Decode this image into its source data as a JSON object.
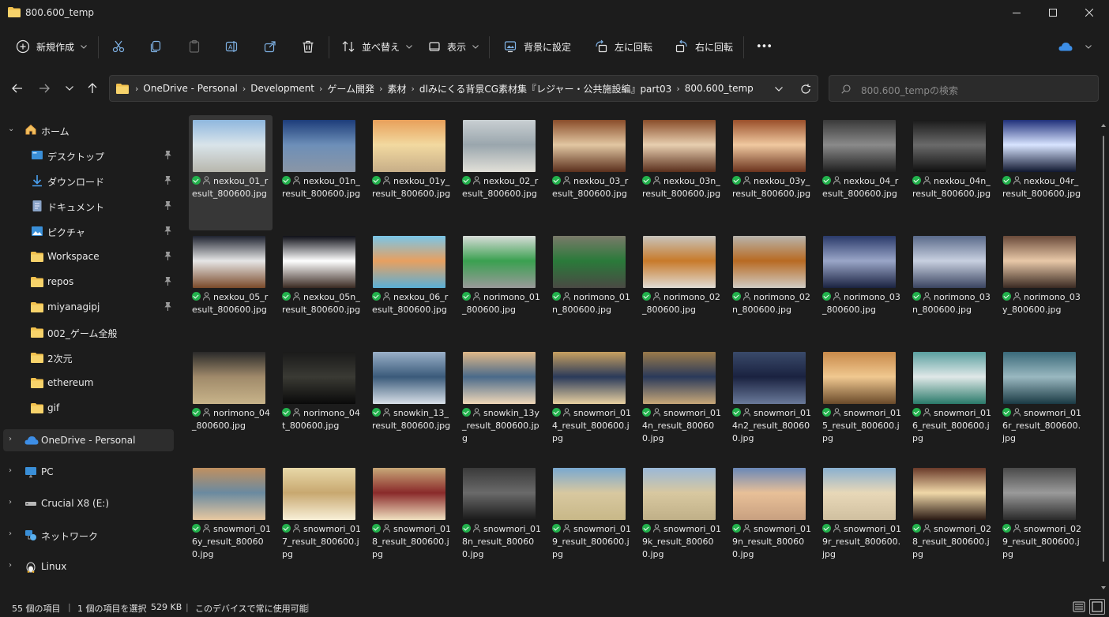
{
  "window": {
    "title": "800.600_temp"
  },
  "toolbar": {
    "new_label": "新規作成",
    "sort_label": "並べ替え",
    "view_label": "表示",
    "wallpaper_label": "背景に設定",
    "rotate_left_label": "左に回転",
    "rotate_right_label": "右に回転",
    "more_label": "•••"
  },
  "address": {
    "crumbs": [
      "OneDrive - Personal",
      "Development",
      "ゲーム開発",
      "素材",
      "dlみにくる背景CG素材集『レジャー・公共施設編』part03",
      "800.600_temp"
    ]
  },
  "search": {
    "placeholder": "800.600_tempの検索"
  },
  "sidebar": {
    "home": "ホーム",
    "quick": [
      "デスクトップ",
      "ダウンロード",
      "ドキュメント",
      "ピクチャ",
      "Workspace",
      "repos",
      "miyanagipj",
      "002_ゲーム全般",
      "2次元",
      "ethereum",
      "gif"
    ],
    "onedrive": "OneDrive - Personal",
    "pc": "PC",
    "drive": "Crucial X8 (E:)",
    "network": "ネットワーク",
    "linux": "Linux"
  },
  "files": [
    {
      "name": "nexkou_01_result_800600.jpg",
      "palette": [
        "#8fb7de",
        "#d9e4ea",
        "#b8b7ad"
      ]
    },
    {
      "name": "nexkou_01n_result_800600.jpg",
      "palette": [
        "#1d3d7a",
        "#6d8fb8",
        "#8a96a6"
      ]
    },
    {
      "name": "nexkou_01y_result_800600.jpg",
      "palette": [
        "#e8a05a",
        "#f2d9a0",
        "#c7ae88"
      ]
    },
    {
      "name": "nexkou_02_result_800600.jpg",
      "palette": [
        "#c9cfd2",
        "#9aa6ad",
        "#e2e0d8"
      ]
    },
    {
      "name": "nexkou_03_result_800600.jpg",
      "palette": [
        "#8a4d2a",
        "#e2c7a2",
        "#5a2f1c"
      ]
    },
    {
      "name": "nexkou_03n_result_800600.jpg",
      "palette": [
        "#8a4d2a",
        "#e8cfb0",
        "#5a2f1c"
      ]
    },
    {
      "name": "nexkou_03y_result_800600.jpg",
      "palette": [
        "#9a4f2a",
        "#f0c9a0",
        "#6a321c"
      ]
    },
    {
      "name": "nexkou_04_result_800600.jpg",
      "palette": [
        "#3a3a3a",
        "#8a8a8a",
        "#1f1f1f"
      ]
    },
    {
      "name": "nexkou_04n_result_800600.jpg",
      "palette": [
        "#1a1a1a",
        "#6a6a6a",
        "#101010"
      ]
    },
    {
      "name": "nexkou_04r_result_800600.jpg",
      "palette": [
        "#20307a",
        "#d8e4ff",
        "#101830"
      ]
    },
    {
      "name": "nexkou_05_result_800600.jpg",
      "palette": [
        "#1f2330",
        "#e6e6e6",
        "#7a4a2a"
      ]
    },
    {
      "name": "nexkou_05n_result_800600.jpg",
      "palette": [
        "#0f1018",
        "#ffffff",
        "#3a2a22"
      ]
    },
    {
      "name": "nexkou_06_result_800600.jpg",
      "palette": [
        "#7ac6e8",
        "#e8a060",
        "#5ab0d8"
      ]
    },
    {
      "name": "norimono_01_800600.jpg",
      "palette": [
        "#d8dcd8",
        "#3aa050",
        "#9a9a9a"
      ]
    },
    {
      "name": "norimono_01n_800600.jpg",
      "palette": [
        "#7a7a6a",
        "#2a7a3a",
        "#4a4a44"
      ]
    },
    {
      "name": "norimono_02_800600.jpg",
      "palette": [
        "#c8c4bc",
        "#c87a2a",
        "#e0dcd4"
      ]
    },
    {
      "name": "norimono_02n_800600.jpg",
      "palette": [
        "#b8b4ac",
        "#b86a22",
        "#d0ccc4"
      ]
    },
    {
      "name": "norimono_03_800600.jpg",
      "palette": [
        "#2a3a6a",
        "#9aa6c8",
        "#1a2240"
      ]
    },
    {
      "name": "norimono_03n_800600.jpg",
      "palette": [
        "#5a6a8a",
        "#c8d0e0",
        "#3a4460"
      ]
    },
    {
      "name": "norimono_03y_800600.jpg",
      "palette": [
        "#6a4a3a",
        "#e8c8a8",
        "#3a2a22"
      ]
    },
    {
      "name": "norimono_04_800600.jpg",
      "palette": [
        "#2a2a2a",
        "#a08a6a",
        "#c8b48a"
      ]
    },
    {
      "name": "norimono_04t_800600.jpg",
      "palette": [
        "#1a1a1a",
        "#3a3a34",
        "#0a0a0a"
      ]
    },
    {
      "name": "snowkin_13_result_800600.jpg",
      "palette": [
        "#9ab0c8",
        "#3a5a7a",
        "#d8e0e8"
      ]
    },
    {
      "name": "snowkin_13y_result_800600.jpg",
      "palette": [
        "#e0b888",
        "#4a6a8a",
        "#f0d8b8"
      ]
    },
    {
      "name": "snowmori_014_result_800600.jpg",
      "palette": [
        "#c8a060",
        "#2a3a5a",
        "#e8d0a0"
      ]
    },
    {
      "name": "snowmori_014n_result_800600.jpg",
      "palette": [
        "#9a7a4a",
        "#2a3a5a",
        "#c8a878"
      ]
    },
    {
      "name": "snowmori_014n2_result_800600.jpg",
      "palette": [
        "#3a4a6a",
        "#1a2240",
        "#6a7a9a"
      ]
    },
    {
      "name": "snowmori_015_result_800600.jpg",
      "palette": [
        "#c88a4a",
        "#f0c890",
        "#6a4a2a"
      ]
    },
    {
      "name": "snowmori_016_result_800600.jpg",
      "palette": [
        "#5aa0a0",
        "#e0e8e8",
        "#2a7a6a"
      ]
    },
    {
      "name": "snowmori_016r_result_800600.jpg",
      "palette": [
        "#3a6a7a",
        "#9ab8c0",
        "#1a3a44"
      ]
    },
    {
      "name": "snowmori_016y_result_800600.jpg",
      "palette": [
        "#c09060",
        "#6a8aa0",
        "#e8c8a0"
      ]
    },
    {
      "name": "snowmori_017_result_800600.jpg",
      "palette": [
        "#e8d8a8",
        "#c8a870",
        "#f8f0d8"
      ]
    },
    {
      "name": "snowmori_018_result_800600.jpg",
      "palette": [
        "#c8a878",
        "#8a2a2a",
        "#f0e0c0"
      ]
    },
    {
      "name": "snowmori_018n_result_800600.jpg",
      "palette": [
        "#3a3a3a",
        "#6a6a6a",
        "#1a1a1a"
      ]
    },
    {
      "name": "snowmori_019_result_800600.jpg",
      "palette": [
        "#7aa8d0",
        "#d8c8a0",
        "#c8b888"
      ]
    },
    {
      "name": "snowmori_019k_result_800600.jpg",
      "palette": [
        "#9ab8d8",
        "#d8c8a0",
        "#c0b088"
      ]
    },
    {
      "name": "snowmori_019n_result_800600.jpg",
      "palette": [
        "#6a88b8",
        "#e8c098",
        "#c8a080"
      ]
    },
    {
      "name": "snowmori_019r_result_800600.jpg",
      "palette": [
        "#8ab0d0",
        "#e8d8b8",
        "#d0c0a0"
      ]
    },
    {
      "name": "snowmori_028_result_800600.jpg",
      "palette": [
        "#6a3a2a",
        "#f0d8a8",
        "#2a1a14"
      ]
    },
    {
      "name": "snowmori_029_result_800600.jpg",
      "palette": [
        "#4a4a4a",
        "#9a9a9a",
        "#2a2a2a"
      ]
    }
  ],
  "selected_index": 0,
  "status": {
    "count": "55 個の項目",
    "selection": "1 個の項目を選択",
    "size": "529 KB",
    "availability": "このデバイスで常に使用可能"
  }
}
